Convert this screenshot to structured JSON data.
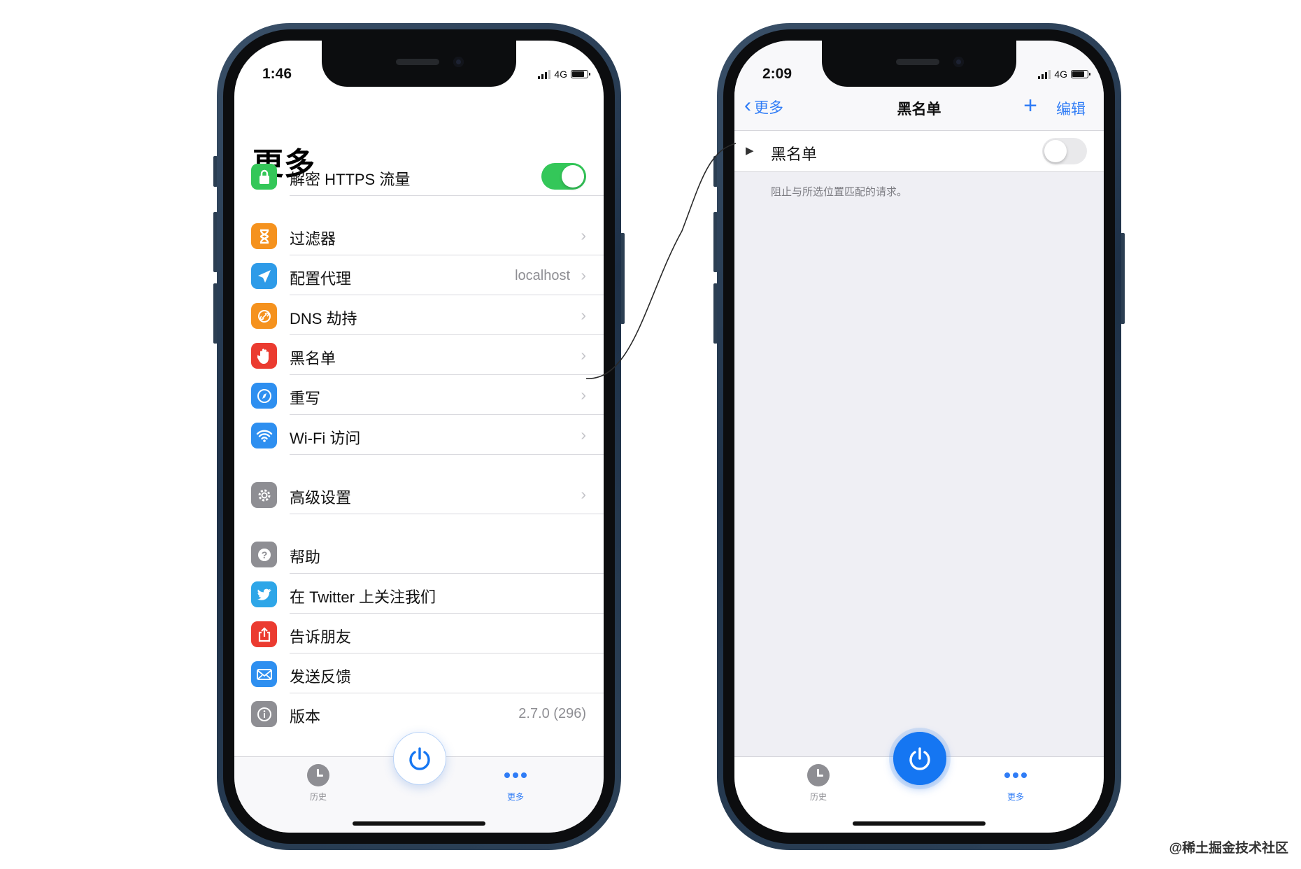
{
  "left_phone": {
    "status_time": "1:46",
    "network": "4G",
    "large_title": "更多",
    "https_row": {
      "label": "解密 HTTPS 流量",
      "enabled": true
    },
    "rows": [
      {
        "label": "过滤器",
        "icon": "hourglass-icon",
        "color": "#f5921e",
        "value": ""
      },
      {
        "label": "配置代理",
        "icon": "paper-plane-icon",
        "color": "#2e9be8",
        "value": "localhost"
      },
      {
        "label": "DNS 劫持",
        "icon": "link-icon",
        "color": "#f5921e",
        "value": ""
      },
      {
        "label": "黑名单",
        "icon": "hand-icon",
        "color": "#eb3b30",
        "value": ""
      },
      {
        "label": "重写",
        "icon": "compass-icon",
        "color": "#2e8ff0",
        "value": ""
      },
      {
        "label": "Wi-Fi 访问",
        "icon": "wifi-icon",
        "color": "#2e8ff0",
        "value": ""
      }
    ],
    "advanced": {
      "label": "高级设置",
      "icon": "gear-icon",
      "color": "#8e8e93"
    },
    "support_rows": [
      {
        "label": "帮助",
        "icon": "question-icon",
        "color": "#8e8e93"
      },
      {
        "label": "在 Twitter 上关注我们",
        "icon": "twitter-bird-icon",
        "color": "#2ea6e8"
      },
      {
        "label": "告诉朋友",
        "icon": "share-icon",
        "color": "#eb3b30"
      },
      {
        "label": "发送反馈",
        "icon": "mail-icon",
        "color": "#2e8ff0"
      }
    ],
    "version_row": {
      "label": "版本",
      "value": "2.7.0 (296)"
    },
    "tabbar": {
      "history": "历史",
      "more": "更多"
    }
  },
  "right_phone": {
    "status_time": "2:09",
    "network": "4G",
    "nav": {
      "back": "更多",
      "title": "黑名单",
      "add": "+",
      "edit": "编辑"
    },
    "cell": {
      "label": "黑名单",
      "enabled": false
    },
    "footer_note": "阻止与所选位置匹配的请求。",
    "tabbar": {
      "history": "历史",
      "more": "更多"
    }
  },
  "watermark": "@稀土掘金技术社区",
  "colors": {
    "accent": "#2f7cf6",
    "toggle_on": "#34c759",
    "power_on": "#1576f2"
  }
}
